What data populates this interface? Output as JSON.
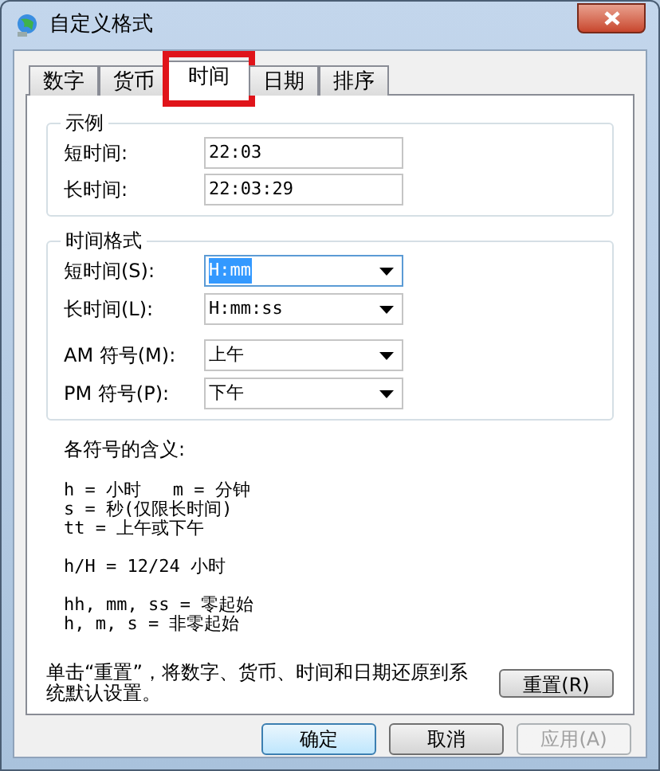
{
  "window": {
    "title": "自定义格式"
  },
  "tabs": [
    {
      "label": "数字",
      "selected": false,
      "highlighted": false
    },
    {
      "label": "货币",
      "selected": false,
      "highlighted": false
    },
    {
      "label": "时间",
      "selected": true,
      "highlighted": true
    },
    {
      "label": "日期",
      "selected": false,
      "highlighted": false
    },
    {
      "label": "排序",
      "selected": false,
      "highlighted": false
    }
  ],
  "sample": {
    "title": "示例",
    "rows": [
      {
        "label": "短时间:",
        "value": "22:03"
      },
      {
        "label": "长时间:",
        "value": "22:03:29"
      }
    ]
  },
  "time_format": {
    "title": "时间格式",
    "rows": [
      {
        "label": "短时间(S):",
        "value": "H:mm",
        "focused": true
      },
      {
        "label": "长时间(L):",
        "value": "H:mm:ss",
        "focused": false
      },
      {
        "label": "AM 符号(M):",
        "value": "上午",
        "focused": false
      },
      {
        "label": "PM 符号(P):",
        "value": "下午",
        "focused": false
      }
    ]
  },
  "legend": {
    "title": "各符号的含义:",
    "groups": [
      [
        "h = 小时   m = 分钟",
        "s = 秒(仅限长时间)",
        "tt = 上午或下午"
      ],
      [
        "h/H = 12/24 小时"
      ],
      [
        "hh, mm, ss = 零起始",
        "h, m, s = 非零起始"
      ]
    ]
  },
  "reset": {
    "text": "单击“重置”，将数字、货币、时间和日期还原到系统默认设置。",
    "button": "重置(R)"
  },
  "buttons": [
    {
      "label": "确定",
      "default": true,
      "disabled": false
    },
    {
      "label": "取消",
      "default": false,
      "disabled": false
    },
    {
      "label": "应用(A)",
      "default": false,
      "disabled": true
    }
  ]
}
